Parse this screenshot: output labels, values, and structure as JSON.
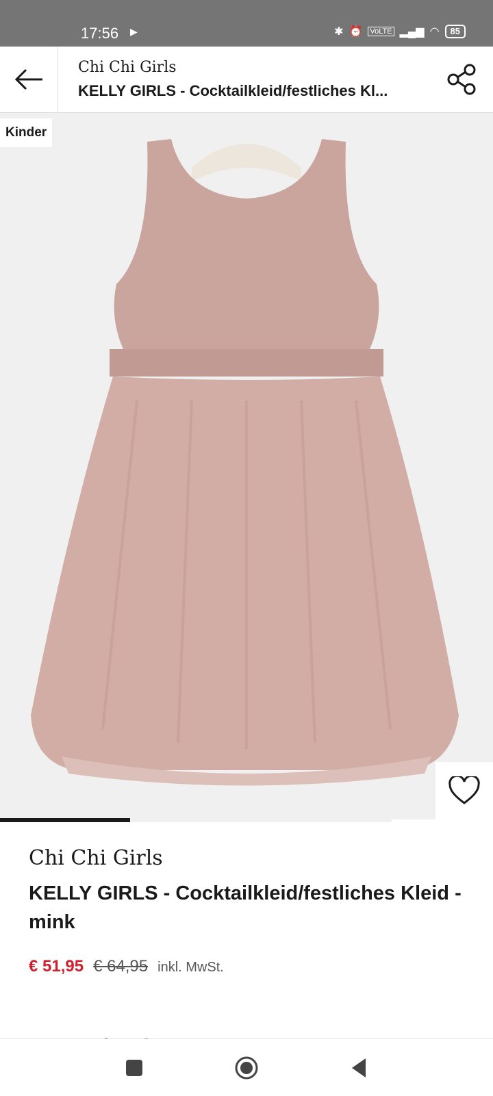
{
  "status_bar": {
    "time": "17:56",
    "battery": "85",
    "icons": [
      "play-icon",
      "bluetooth-icon",
      "alarm-icon",
      "volte-icon",
      "signal-icon",
      "wifi-icon",
      "battery-icon"
    ]
  },
  "header": {
    "brand": "Chi Chi Girls",
    "title": "KELLY GIRLS  - Cocktailkleid/festliches Kl..."
  },
  "image": {
    "badge": "Kinder",
    "dress_color": "#c9a59e"
  },
  "product": {
    "brand": "Chi Chi Girls",
    "title": "KELLY GIRLS  - Cocktailkleid/festliches Kleid - mink",
    "price_current": "€ 51,95",
    "price_original": "€ 64,95",
    "tax_note": "inkl. MwSt.",
    "availability": "Ausverkauft"
  },
  "colors": {
    "sale_red": "#d01f2d",
    "text": "#1a1a1a"
  }
}
